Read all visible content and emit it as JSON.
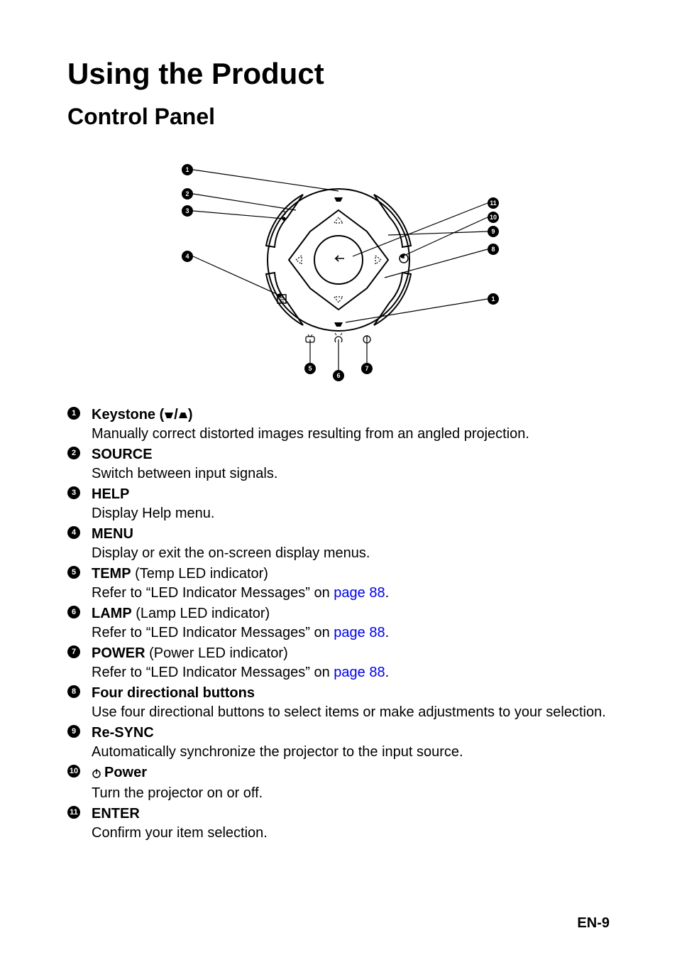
{
  "title": "Using the Product",
  "subtitle": "Control Panel",
  "footer": "EN-9",
  "link_text": "page 88",
  "items": [
    {
      "num": "1",
      "heading": "Keystone (",
      "heading_tail": ")",
      "extra": null,
      "desc": "Manually correct distorted images resulting from an angled projection."
    },
    {
      "num": "2",
      "heading": "SOURCE",
      "heading_tail": "",
      "extra": null,
      "desc": "Switch between input signals."
    },
    {
      "num": "3",
      "heading": "HELP",
      "heading_tail": "",
      "extra": null,
      "desc": "Display Help menu."
    },
    {
      "num": "4",
      "heading": "MENU",
      "heading_tail": "",
      "extra": null,
      "desc": "Display or exit the on-screen display menus."
    },
    {
      "num": "5",
      "heading": "TEMP",
      "heading_tail": "",
      "extra": " (Temp LED indicator)",
      "desc_pre": "Refer to “LED Indicator Messages” on ",
      "desc_post": "."
    },
    {
      "num": "6",
      "heading": "LAMP",
      "heading_tail": "",
      "extra": " (Lamp LED indicator)",
      "desc_pre": "Refer to “LED Indicator Messages” on ",
      "desc_post": "."
    },
    {
      "num": "7",
      "heading": "POWER",
      "heading_tail": "",
      "extra": " (Power LED indicator)",
      "desc_pre": "Refer to “LED Indicator Messages” on ",
      "desc_post": "."
    },
    {
      "num": "8",
      "heading": "Four directional buttons",
      "heading_tail": "",
      "extra": null,
      "desc": "Use four directional buttons to select items or make adjustments to your selection."
    },
    {
      "num": "9",
      "heading": "Re-SYNC",
      "heading_tail": "",
      "extra": null,
      "desc": "Automatically synchronize the projector to the input source."
    },
    {
      "num": "10",
      "heading": "Power",
      "heading_tail": "",
      "extra": null,
      "desc": "Turn the projector on or off."
    },
    {
      "num": "11",
      "heading": "ENTER",
      "heading_tail": "",
      "extra": null,
      "desc": "Confirm your item selection."
    }
  ],
  "callouts": {
    "left": [
      "1",
      "2",
      "3",
      "4"
    ],
    "rightTop": [
      "11",
      "10",
      "9",
      "8"
    ],
    "rightBottom": [
      "1"
    ],
    "bottom": [
      "5",
      "6",
      "7"
    ]
  }
}
